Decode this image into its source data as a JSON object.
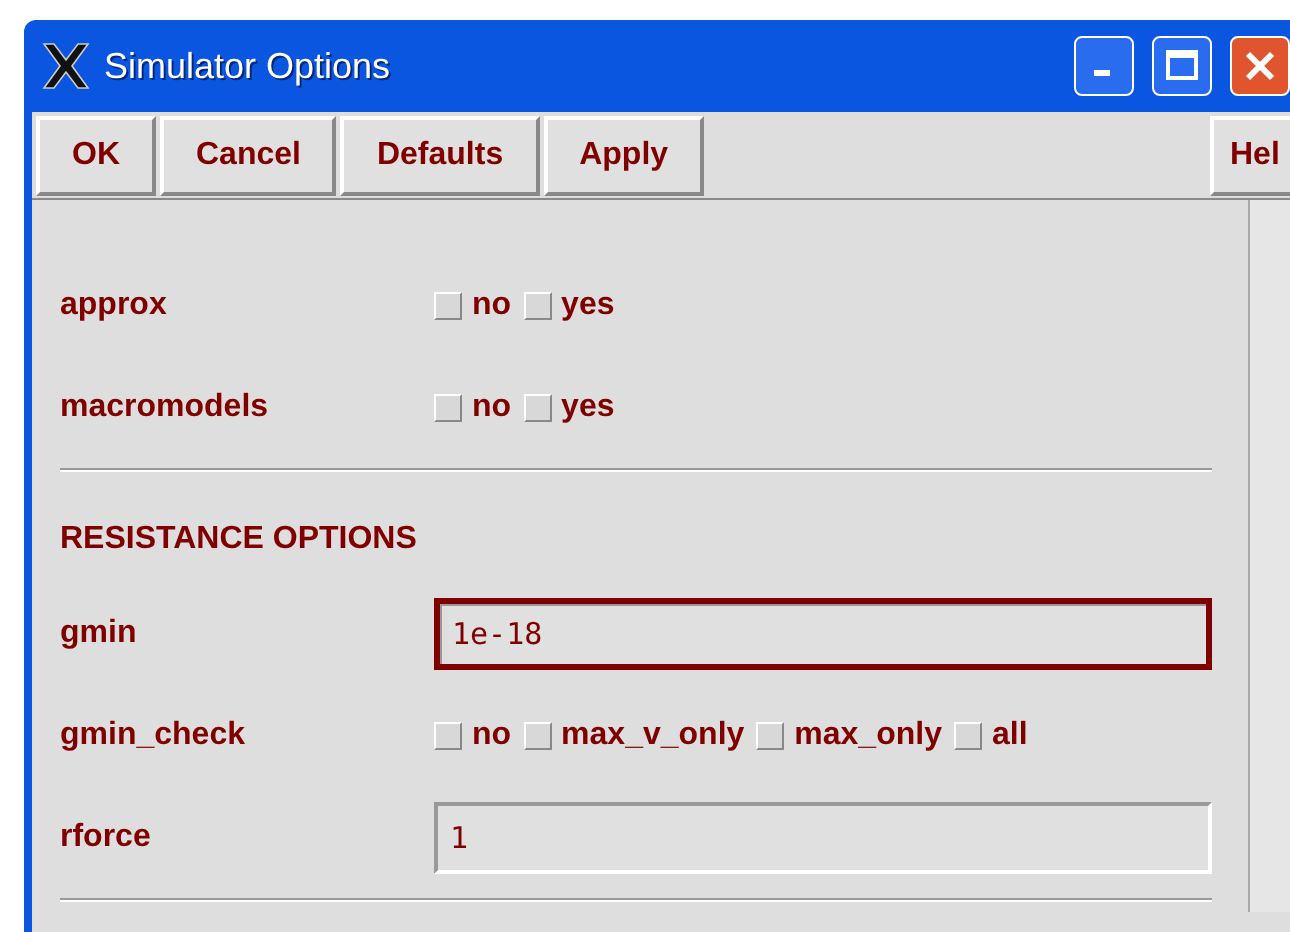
{
  "window": {
    "title": "Simulator Options"
  },
  "toolbar": {
    "buttons": [
      "OK",
      "Cancel",
      "Defaults",
      "Apply"
    ],
    "help_button": "Hel"
  },
  "sections": [
    {
      "kind": "rows",
      "rows": [
        {
          "kind": "checks",
          "label": "approx",
          "options": [
            {
              "label": "no",
              "checked": false
            },
            {
              "label": "yes",
              "checked": false
            }
          ]
        },
        {
          "kind": "checks",
          "label": "macromodels",
          "options": [
            {
              "label": "no",
              "checked": false
            },
            {
              "label": "yes",
              "checked": false
            }
          ]
        }
      ]
    },
    {
      "kind": "rows",
      "heading": "RESISTANCE OPTIONS",
      "rows": [
        {
          "kind": "field",
          "label": "gmin",
          "value": "1e-18",
          "focused": true
        },
        {
          "kind": "checks",
          "label": "gmin_check",
          "options": [
            {
              "label": "no",
              "checked": false
            },
            {
              "label": "max_v_only",
              "checked": false
            },
            {
              "label": "max_only",
              "checked": false
            },
            {
              "label": "all",
              "checked": false
            }
          ]
        },
        {
          "kind": "field",
          "label": "rforce",
          "value": "1",
          "focused": false
        }
      ]
    }
  ]
}
